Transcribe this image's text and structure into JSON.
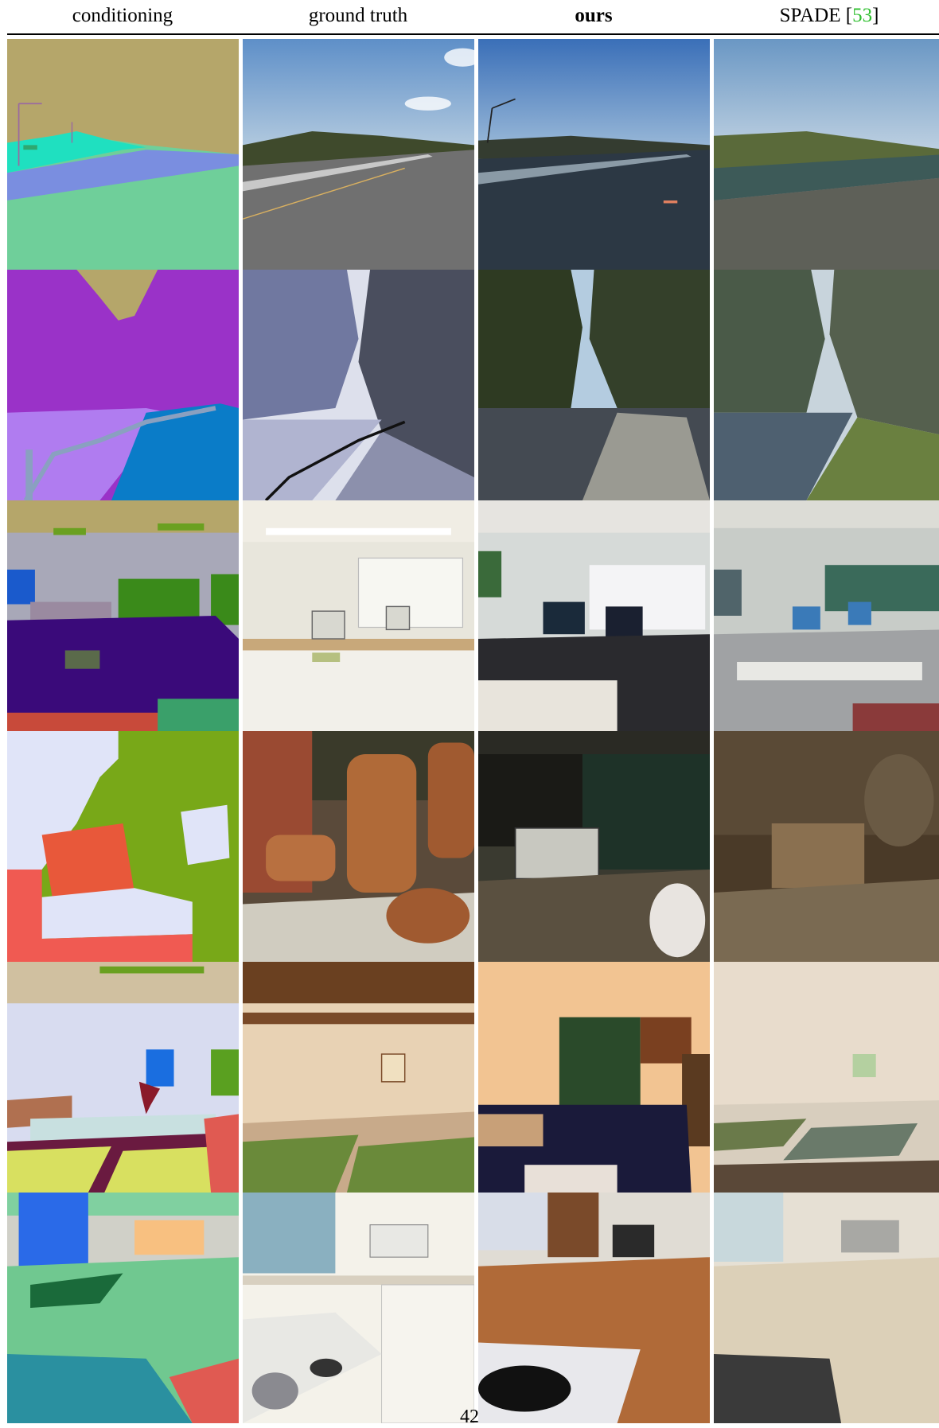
{
  "header": {
    "col1": "conditioning",
    "col2": "ground truth",
    "col3": "ours",
    "col4_name": "SPADE [",
    "col4_ref": "53",
    "col4_close": "]"
  },
  "colors": {
    "citation": "#2fbf2f",
    "rule": "#000000"
  },
  "page_number": "42"
}
